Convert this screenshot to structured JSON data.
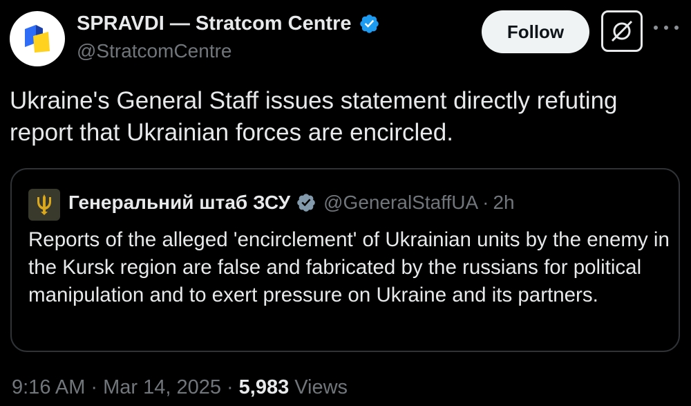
{
  "author": {
    "display_name": "SPRAVDI — Stratcom Centre",
    "handle": "@StratcomCentre",
    "verified": true,
    "verified_color": "#1d9bf0",
    "avatar_icon": "spravdi-logo-icon"
  },
  "actions": {
    "follow_label": "Follow",
    "grok_icon": "grok-icon",
    "more_icon": "more-dots-icon"
  },
  "tweet": {
    "text": "Ukraine's General Staff issues statement directly refuting report that Ukrainian forces are encircled."
  },
  "quoted_tweet": {
    "display_name": "Генеральний штаб ЗСУ",
    "handle": "@GeneralStaffUA",
    "separator": "·",
    "time_ago": "2h",
    "verified": true,
    "verified_color": "#829aab",
    "avatar_icon": "trident-emblem-icon",
    "text": "Reports of the alleged 'encirclement' of Ukrainian units by the enemy in the Kursk region are false and fabricated by the russians for political manipulation and to exert pressure on Ukraine and its partners."
  },
  "meta": {
    "time": "9:16 AM",
    "separator": "·",
    "date": "Mar 14, 2025",
    "views_count": "5,983",
    "views_label": "Views"
  },
  "colors": {
    "background": "#000000",
    "text_primary": "#e7e9ea",
    "text_secondary": "#71767b",
    "border": "#2f3336",
    "follow_bg": "#eff3f4"
  }
}
